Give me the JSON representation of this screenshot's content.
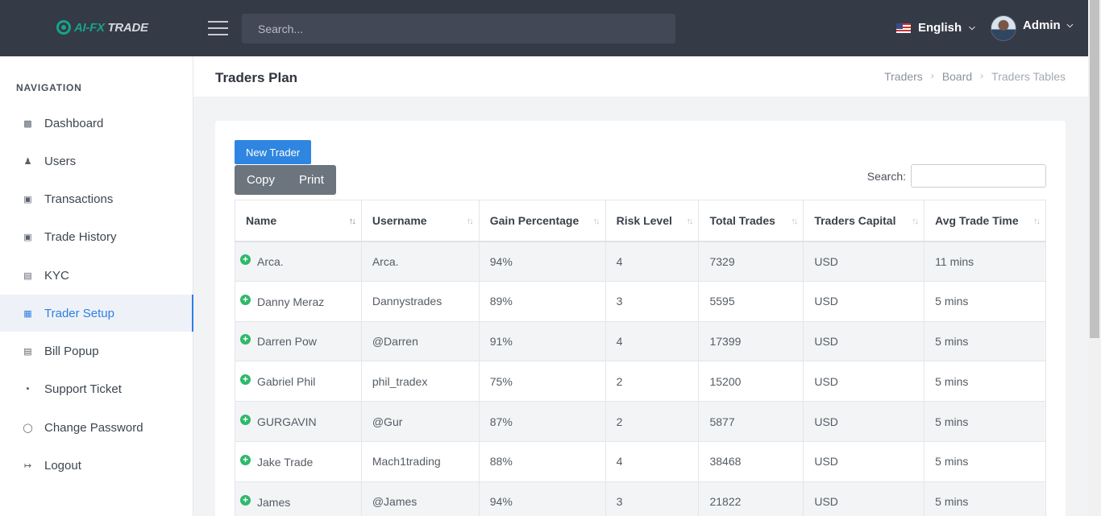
{
  "brand": {
    "logo_a": "AI-FX",
    "logo_b": " TRADE"
  },
  "topbar": {
    "search_placeholder": "Search...",
    "language": "English",
    "user": "Admin"
  },
  "sidebar": {
    "title": "NAVIGATION",
    "items": [
      {
        "label": "Dashboard",
        "icon": "dashboard-icon"
      },
      {
        "label": "Users",
        "icon": "users-icon"
      },
      {
        "label": "Transactions",
        "icon": "money-icon"
      },
      {
        "label": "Trade History",
        "icon": "money-icon"
      },
      {
        "label": "KYC",
        "icon": "id-card-icon"
      },
      {
        "label": "Trader Setup",
        "icon": "setup-icon",
        "active": true
      },
      {
        "label": "Bill Popup",
        "icon": "credit-card-icon"
      },
      {
        "label": "Support Ticket",
        "icon": "support-icon"
      },
      {
        "label": "Change Password",
        "icon": "shield-icon"
      },
      {
        "label": "Logout",
        "icon": "logout-icon"
      }
    ]
  },
  "page": {
    "title": "Traders Plan",
    "breadcrumb": [
      "Traders",
      "Board",
      "Traders Tables"
    ]
  },
  "actions": {
    "new_trader": "New Trader",
    "copy": "Copy",
    "print": "Print",
    "search_label": "Search:"
  },
  "table": {
    "columns": [
      "Name",
      "Username",
      "Gain Percentage",
      "Risk Level",
      "Total Trades",
      "Traders Capital",
      "Avg Trade Time"
    ],
    "rows": [
      [
        "Arca.",
        "Arca.",
        "94%",
        "4",
        "7329",
        "USD",
        "11 mins"
      ],
      [
        "Danny Meraz",
        "Dannystrades",
        "89%",
        "3",
        "5595",
        "USD",
        "5 mins"
      ],
      [
        "Darren Pow",
        "@Darren",
        "91%",
        "4",
        "17399",
        "USD",
        "5 mins"
      ],
      [
        "Gabriel Phil",
        "phil_tradex",
        "75%",
        "2",
        "15200",
        "USD",
        "5 mins"
      ],
      [
        "GURGAVIN",
        "@Gur",
        "87%",
        "2",
        "5877",
        "USD",
        "5 mins"
      ],
      [
        "Jake Trade",
        "Mach1trading",
        "88%",
        "4",
        "38468",
        "USD",
        "5 mins"
      ],
      [
        "James",
        "@James",
        "94%",
        "3",
        "21822",
        "USD",
        "5 mins"
      ]
    ]
  },
  "colors": {
    "accent": "#2f86e0",
    "topbar": "#343a46",
    "brand": "#19a389",
    "expand": "#2eb86b"
  }
}
